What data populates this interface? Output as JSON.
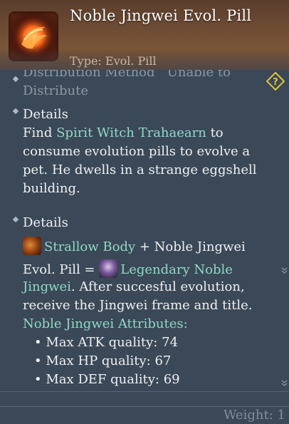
{
  "header": {
    "title": "Noble Jingwei Evol. Pill",
    "type_label": "Type: Evol. Pill",
    "icon": "fire-pill-icon"
  },
  "distribution": {
    "label": "Distribution Method",
    "value": "Unable to",
    "value_cont": "Distribute"
  },
  "details1": {
    "heading": "Details",
    "line1_pre": "Find ",
    "npc": "Spirit Witch Trahaearn",
    "line1_post": " to",
    "line2": "consume evolution pills to evolve a",
    "line3": "pet. He dwells in a strange eggshell",
    "line4": "building."
  },
  "details2": {
    "heading": "Details",
    "pet_name": "Strallow Body",
    "plus": " + Noble Jingwei",
    "line2_pre": "Evol. Pill = ",
    "result": "Legendary Noble",
    "result_cont": "Jingwei",
    "line3_post": ". After succesful evolution,",
    "line4": "receive the Jingwei frame and title.",
    "attributes_heading": "Noble Jingwei Attributes:",
    "attributes": [
      "Max ATK quality: 74",
      "Max HP quality: 67",
      "Max DEF quality: 69"
    ]
  },
  "footer": {
    "weight": "Weight: 1"
  },
  "colors": {
    "background": "#3b4858",
    "highlight": "#8fd9c6",
    "muted": "#8f98a3",
    "help_icon": "#e3c53a"
  }
}
